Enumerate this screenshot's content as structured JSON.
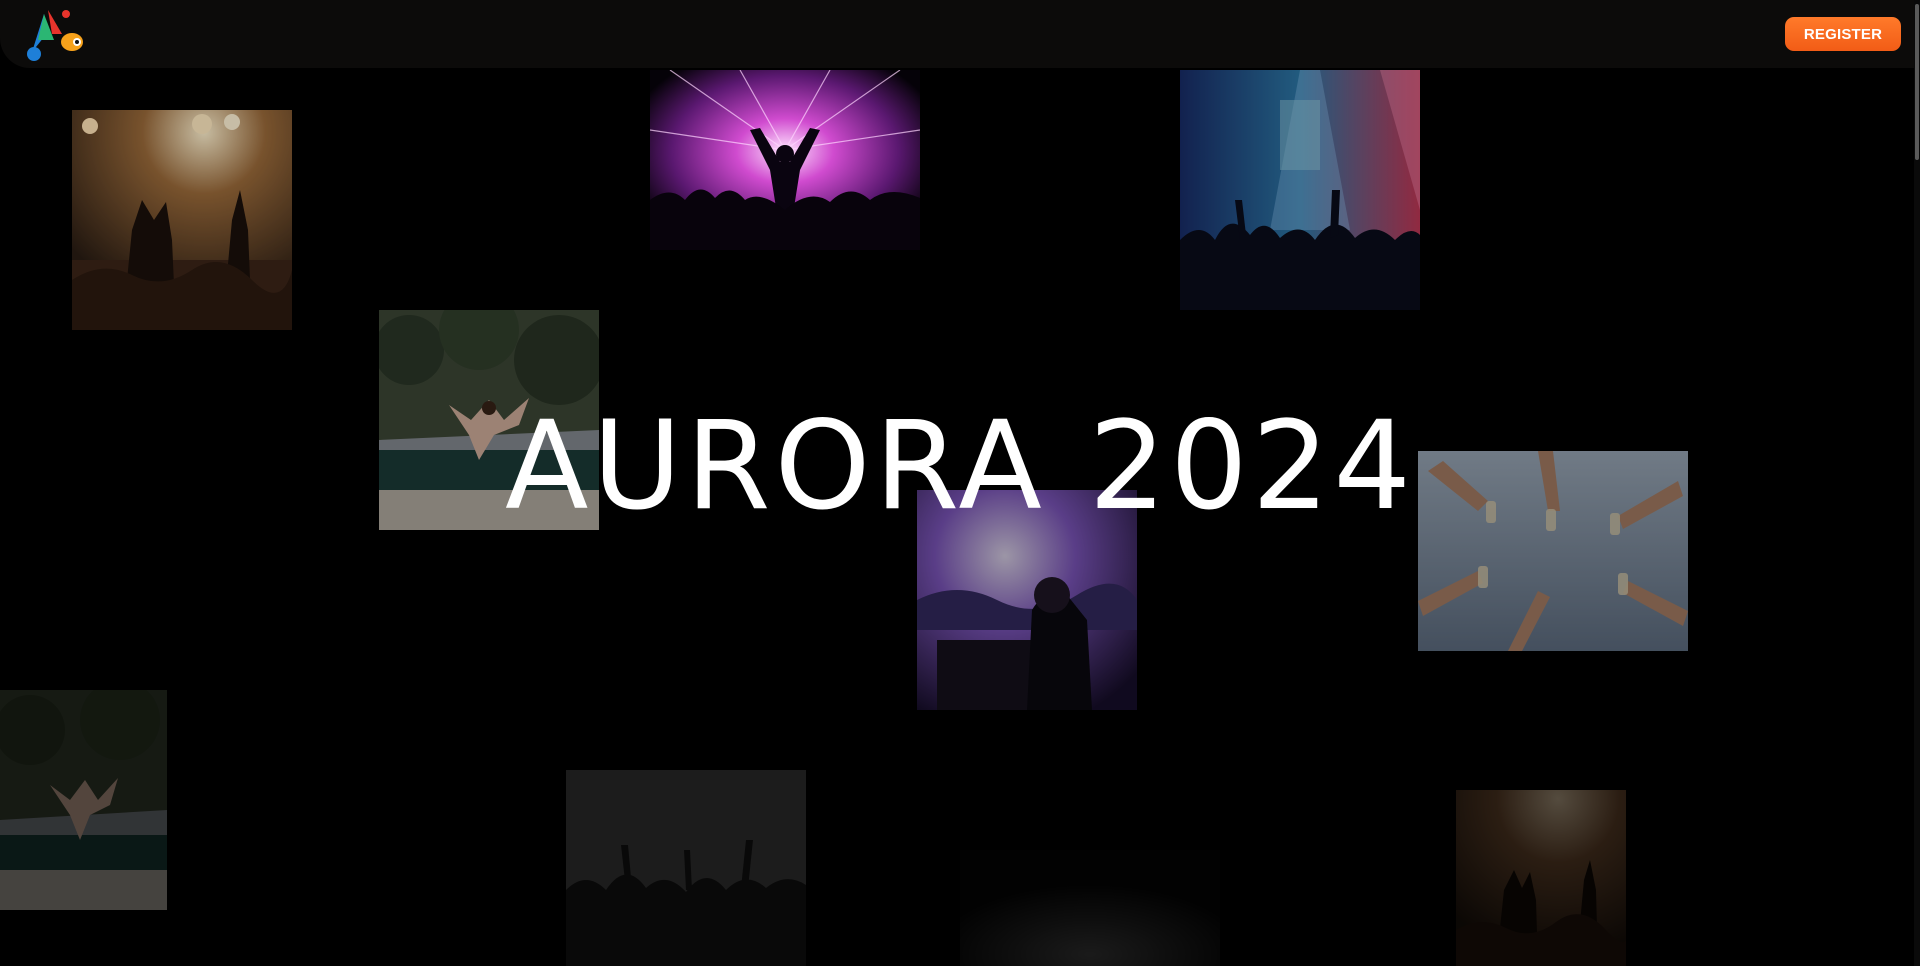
{
  "header": {
    "logo_icon": "aurora-festival-logo",
    "register_label": "REGISTER",
    "accent_color": "#f66a1f"
  },
  "hero": {
    "title": "AURORA 2024"
  },
  "gallery": {
    "tiles": [
      {
        "subject": "crowd-heart-hands"
      },
      {
        "subject": "silhouette-laser-show"
      },
      {
        "subject": "concert-stage-lights"
      },
      {
        "subject": "pool-party-jump"
      },
      {
        "subject": "dj-booth-crowd"
      },
      {
        "subject": "champagne-toast"
      },
      {
        "subject": "pool-party-jump"
      },
      {
        "subject": "crowd-cheering"
      },
      {
        "subject": "dark-stage"
      },
      {
        "subject": "crowd-heart-hands"
      }
    ]
  }
}
